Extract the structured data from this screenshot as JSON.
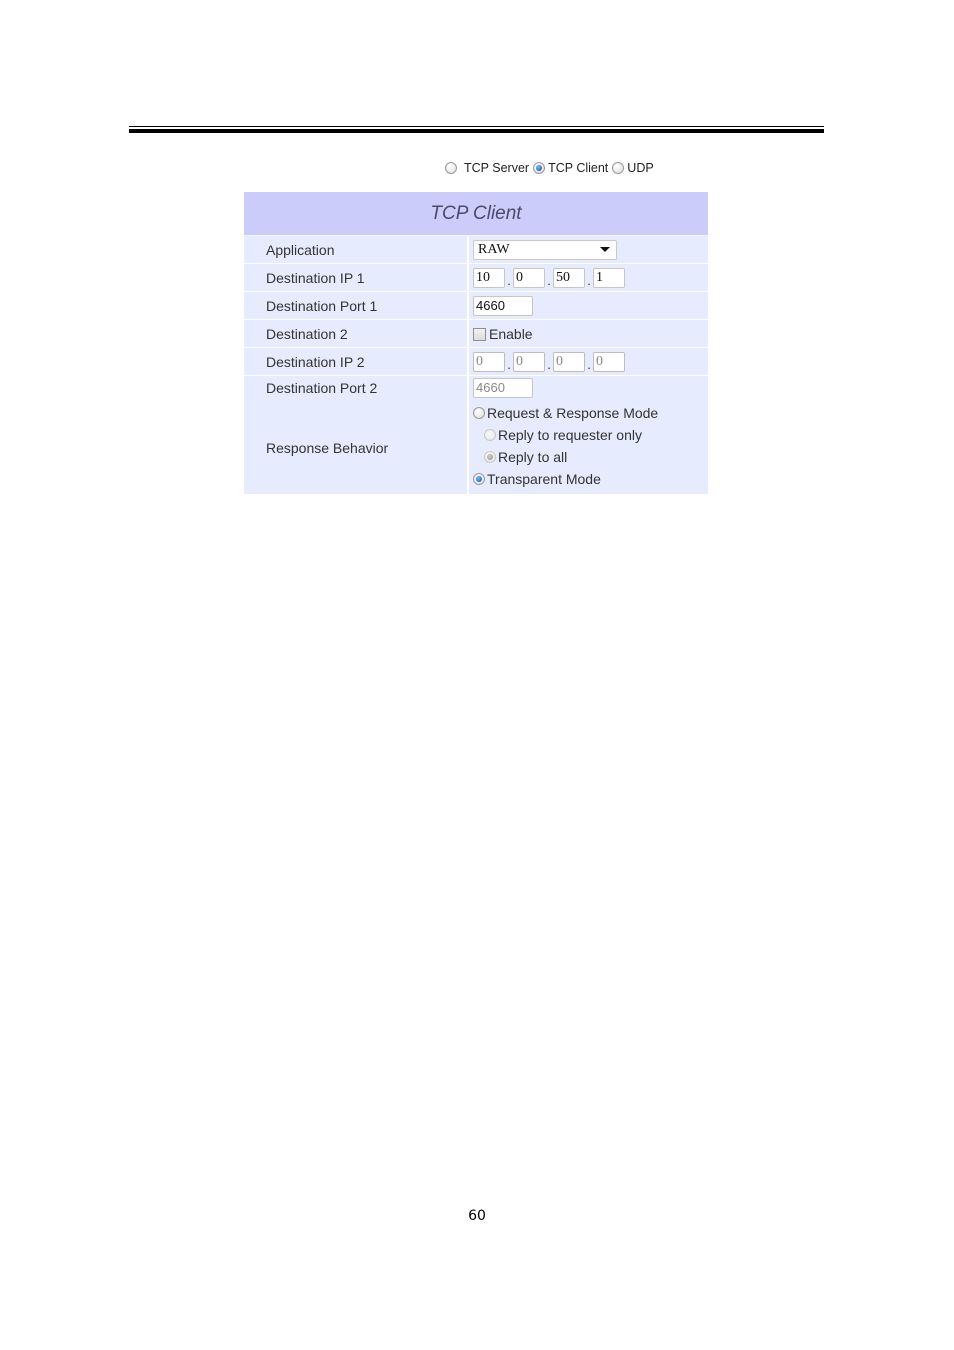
{
  "mode_selector": {
    "options": [
      {
        "label": "TCP Server",
        "selected": false
      },
      {
        "label": "TCP Client",
        "selected": true
      },
      {
        "label": "UDP",
        "selected": false
      }
    ]
  },
  "panel": {
    "title": "TCP Client",
    "rows": {
      "application": {
        "label": "Application",
        "value": "RAW"
      },
      "dest_ip1": {
        "label": "Destination IP 1",
        "octets": [
          "10",
          "0",
          "50",
          "1"
        ]
      },
      "dest_port1": {
        "label": "Destination Port 1",
        "value": "4660"
      },
      "dest2": {
        "label": "Destination 2",
        "checkbox_label": "Enable",
        "checked": false
      },
      "dest_ip2": {
        "label": "Destination IP 2",
        "octets": [
          "0",
          "0",
          "0",
          "0"
        ]
      },
      "dest_port2": {
        "label": "Destination Port 2",
        "value": "4660"
      },
      "response": {
        "label": "Response Behavior",
        "options": [
          {
            "label": "Request & Response Mode",
            "selected": false
          },
          {
            "label": "Reply to requester only",
            "selected": false,
            "disabled": true
          },
          {
            "label": "Reply to all",
            "selected": true,
            "disabled": true
          },
          {
            "label": "Transparent Mode",
            "selected": true
          }
        ]
      }
    }
  },
  "footer": {
    "page_number": "60"
  }
}
